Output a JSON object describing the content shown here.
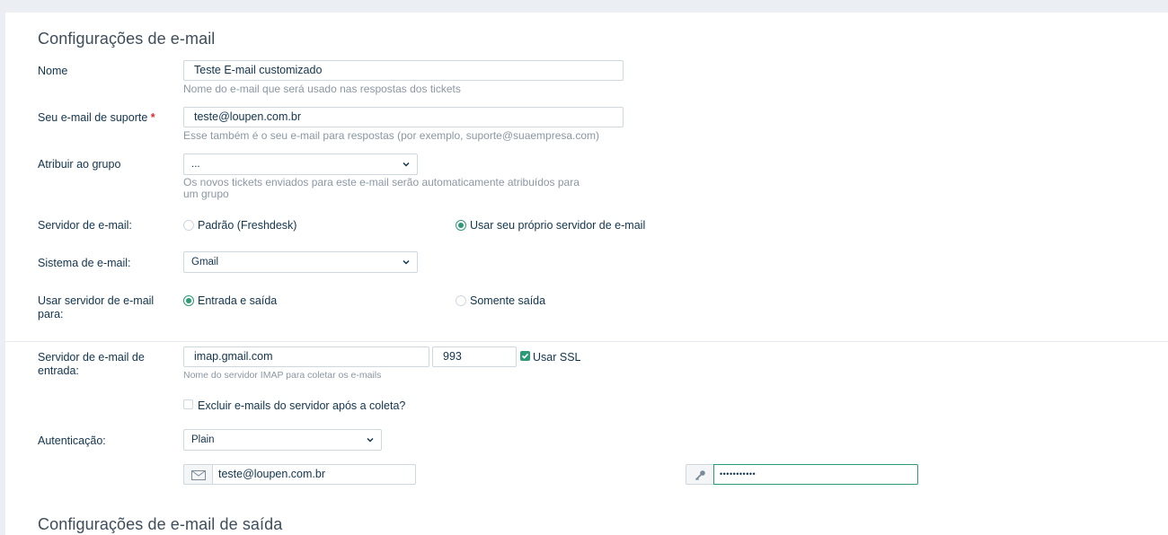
{
  "section_title": "Configurações de e-mail",
  "fields": {
    "name": {
      "label": "Nome",
      "value": "Teste E-mail customizado",
      "hint": "Nome do e-mail que será usado nas respostas dos tickets"
    },
    "support_email": {
      "label": "Seu e-mail de suporte",
      "required_mark": "*",
      "value": "teste@loupen.com.br",
      "hint": "Esse também é o seu e-mail para respostas (por exemplo, suporte@suaempresa.com)"
    },
    "group": {
      "label": "Atribuir ao grupo",
      "value": "...",
      "hint_line1": "Os novos tickets enviados para este e-mail serão automaticamente atribuídos para",
      "hint_line2": "um grupo"
    },
    "mail_server": {
      "label": "Servidor de e-mail:",
      "option_default": "Padrão (Freshdesk)",
      "option_own": "Usar seu próprio servidor de e-mail",
      "selected": "own"
    },
    "mail_system": {
      "label": "Sistema de e-mail:",
      "value": "Gmail"
    },
    "use_server_for": {
      "label_line1": "Usar servidor de e-mail",
      "label_line2": "para:",
      "option_in_out": "Entrada e saída",
      "option_out_only": "Somente saída",
      "selected": "in_out"
    },
    "incoming_server": {
      "label_line1": "Servidor de e-mail de",
      "label_line2": "entrada:",
      "host": "imap.gmail.com",
      "port": "993",
      "ssl_label": "Usar SSL",
      "ssl_checked": true,
      "hint": "Nome do servidor IMAP para coletar os e-mails",
      "delete_label": "Excluir e-mails do servidor após a coleta?",
      "delete_checked": false
    },
    "auth": {
      "label": "Autenticação:",
      "value": "Plain",
      "username": "teste@loupen.com.br",
      "password": "•••••••••••"
    }
  },
  "outgoing_section_title": "Configurações de e-mail de saída",
  "icons": {
    "mail": "envelope-icon",
    "key": "key-icon",
    "select": "chevron-down-icon"
  },
  "colors": {
    "accent": "#2c9a74",
    "required": "#d72d30",
    "focus_border": "#2c9a74"
  }
}
